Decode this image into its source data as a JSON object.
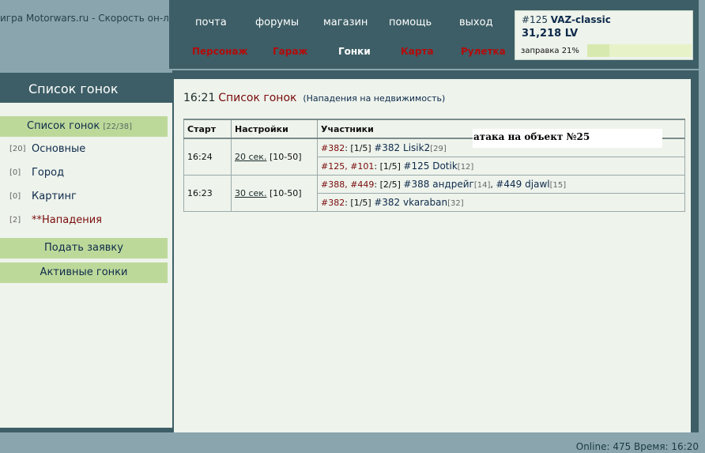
{
  "site_title": "игра Motorwars.ru - Скорость он-лайн",
  "nav": {
    "main": [
      "почта",
      "форумы",
      "магазин",
      "помощь",
      "выход"
    ],
    "sub": [
      "Персонаж",
      "Гараж",
      "Гонки",
      "Карта",
      "Рулетка"
    ],
    "active_sub": "Гонки"
  },
  "info": {
    "car_id": "#125",
    "car_model": "VAZ-classic",
    "balance": "31,218 LV",
    "fuel_label": "заправка 21%",
    "fuel_fraction": 0.21
  },
  "left": {
    "header": "Список гонок",
    "active_item": {
      "label": "Список гонок",
      "count": "[22/38]"
    },
    "items": [
      {
        "num": "[20]",
        "label": "Основные"
      },
      {
        "num": "[0]",
        "label": "Город"
      },
      {
        "num": "[0]",
        "label": "Картинг"
      },
      {
        "num": "[2]",
        "label": "**Нападения"
      }
    ],
    "buttons": [
      "Подать заявку",
      "Активные гонки"
    ]
  },
  "main": {
    "time": "16:21",
    "title": "Список гонок",
    "subtitle": "(Нападения на недвижимость)",
    "columns": [
      "Старт",
      "Настройки",
      "Участники"
    ],
    "races": [
      {
        "start": "16:24",
        "settings_link": "20 сек.",
        "settings_range": "[10-50]",
        "entries": [
          {
            "cars": "#382",
            "slots": "[1/5]",
            "players": [
              {
                "id": "#382",
                "nick": "Lisik2",
                "rank": "[29]"
              }
            ]
          },
          {
            "cars": "#125, #101",
            "slots": "[1/5]",
            "players": [
              {
                "id": "#125",
                "nick": "Dotik",
                "rank": "[12]"
              }
            ]
          }
        ]
      },
      {
        "start": "16:23",
        "settings_link": "30 сек.",
        "settings_range": "[10-50]",
        "entries": [
          {
            "cars": "#388, #449",
            "slots": "[2/5]",
            "players": [
              {
                "id": "#388",
                "nick": "андрейг",
                "rank": "[14]"
              },
              {
                "id": "#449",
                "nick": "djawl",
                "rank": "[15]"
              }
            ]
          },
          {
            "cars": "#382",
            "slots": "[1/5]",
            "players": [
              {
                "id": "#382",
                "nick": "vkaraban",
                "rank": "[32]"
              }
            ]
          }
        ]
      }
    ],
    "tooltip": "атака на объект №25"
  },
  "status": {
    "online": "Online: 475",
    "time": "Время: 16:20"
  }
}
